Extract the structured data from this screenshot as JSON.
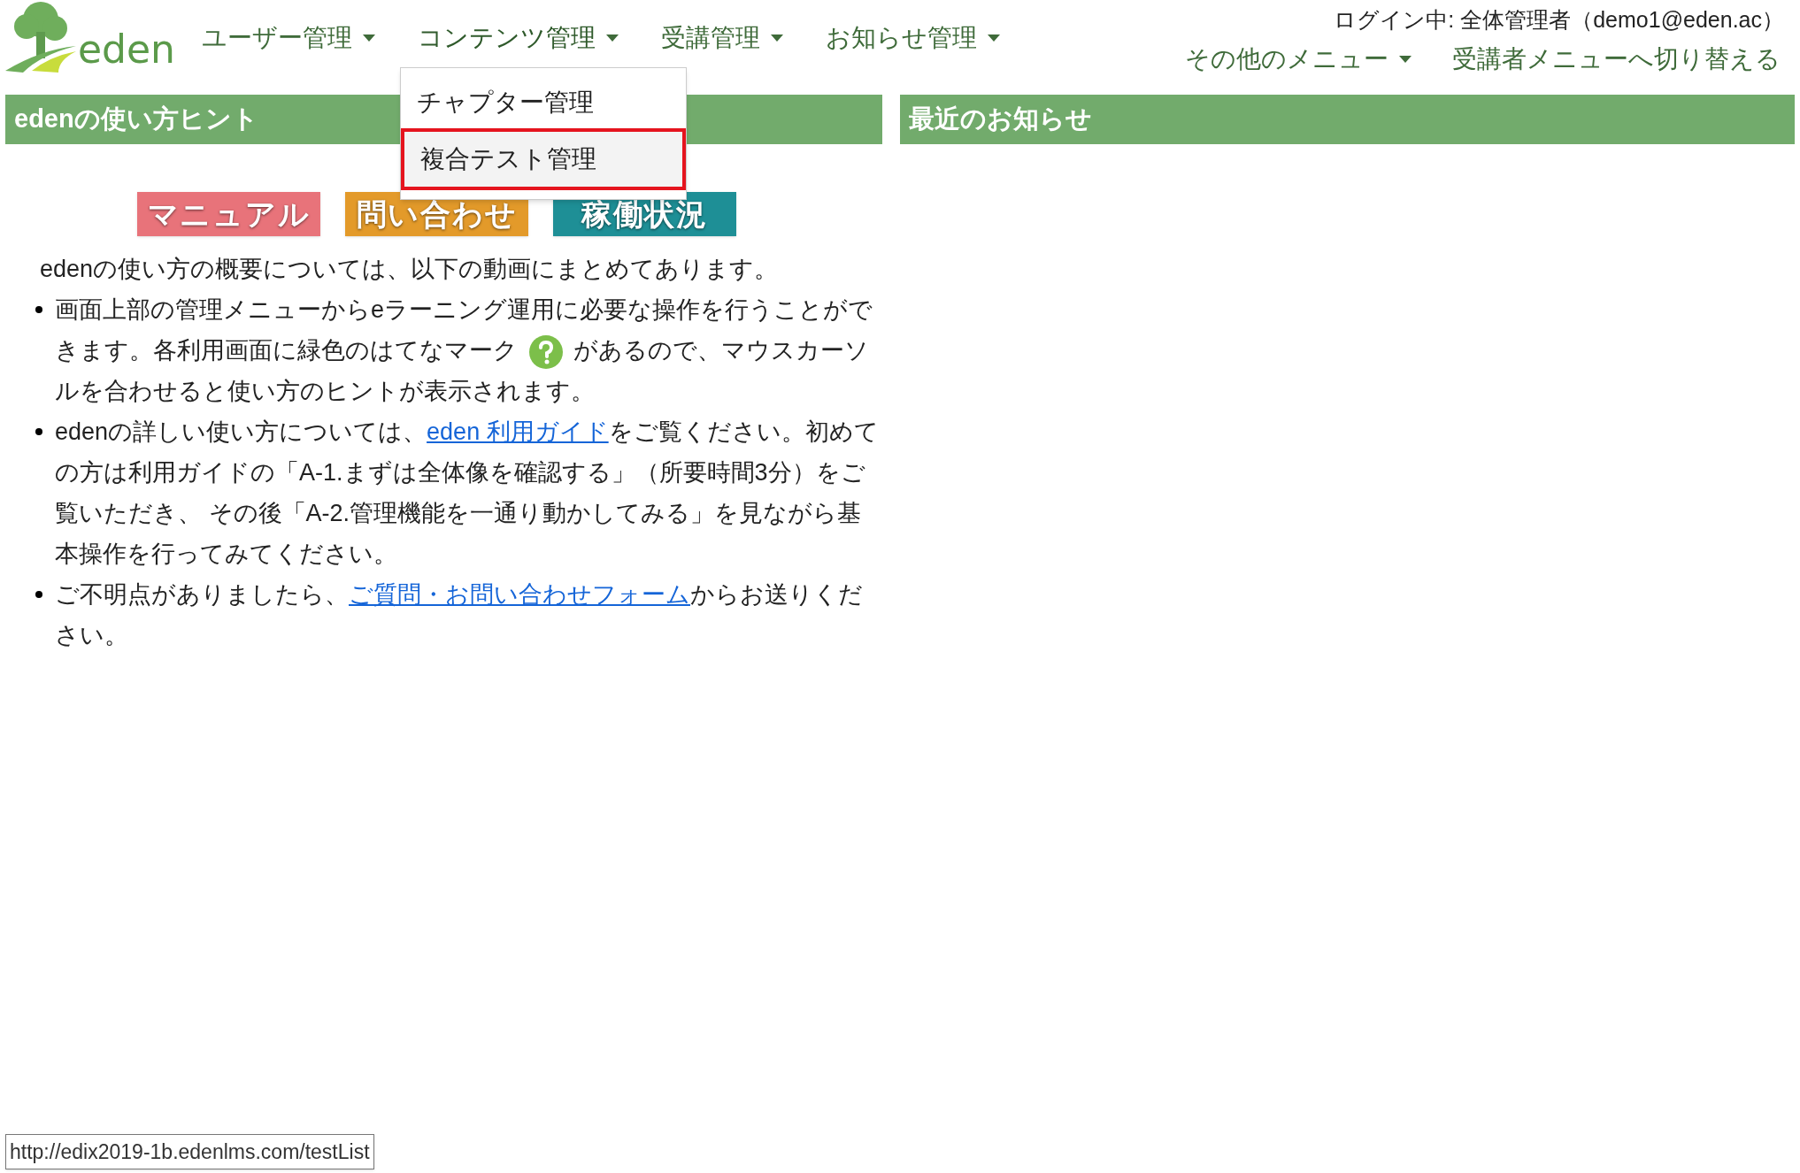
{
  "logo": {
    "text": "eden"
  },
  "nav": [
    {
      "label": "ユーザー管理",
      "expanded": false
    },
    {
      "label": "コンテンツ管理",
      "expanded": true
    },
    {
      "label": "受講管理",
      "expanded": false
    },
    {
      "label": "お知らせ管理",
      "expanded": false
    }
  ],
  "dropdown": [
    {
      "label": "チャプター管理",
      "selected": false
    },
    {
      "label": "複合テスト管理",
      "selected": true
    }
  ],
  "login": "ログイン中: 全体管理者（demo1@eden.ac）",
  "right_menu": [
    {
      "label": "その他のメニュー",
      "kind": "dropdown"
    },
    {
      "label": "受講者メニューへ切り替える",
      "kind": "link"
    }
  ],
  "hint_panel": {
    "title": "edenの使い方ヒント",
    "buttons": [
      {
        "label": "マニュアル",
        "color": "#e8737a"
      },
      {
        "label": "問い合わせ",
        "color": "#e39a2a"
      },
      {
        "label": "稼働状況",
        "color": "#1e8f96"
      }
    ],
    "intro": "edenの使い方の概要については、以下の動画にまとめてあります。",
    "bullets": [
      [
        {
          "kind": "text",
          "text": "画面上部の管理メニューからeラーニング運用に必要な操作を行うことができます。各利用画面に緑色のはてなマーク "
        },
        {
          "kind": "help_icon"
        },
        {
          "kind": "text",
          "text": " があるので、マウスカーソルを合わせると使い方のヒントが表示されます。"
        }
      ],
      [
        {
          "kind": "text",
          "text": "edenの詳しい使い方については、"
        },
        {
          "kind": "link",
          "text": "eden 利用ガイド"
        },
        {
          "kind": "text",
          "text": "をご覧ください。初めての方は利用ガイドの「A-1.まずは全体像を確認する」（所要時間3分）をご覧いただき、 その後「A-2.管理機能を一通り動かしてみる」を見ながら基本操作を行ってみてください。"
        }
      ],
      [
        {
          "kind": "text",
          "text": "ご不明点がありましたら、"
        },
        {
          "kind": "link",
          "text": "ご質問・お問い合わせフォーム"
        },
        {
          "kind": "text",
          "text": "からお送りください。"
        }
      ]
    ]
  },
  "news_panel": {
    "title": "最近のお知らせ"
  },
  "status_url": "http://edix2019-1b.edenlms.com/testList"
}
